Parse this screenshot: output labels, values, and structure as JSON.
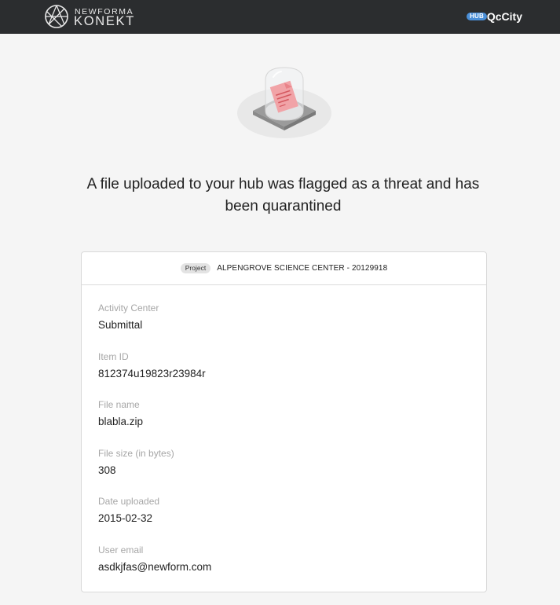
{
  "header": {
    "logo_top": "NEWFORMA",
    "logo_bottom": "KONEKT",
    "hub_badge": "HUB",
    "hub_name": "QcCity"
  },
  "message": {
    "headline": "A file uploaded to your hub was flagged as a threat and has been quarantined"
  },
  "card": {
    "project_badge": "Project",
    "project_name": "ALPENGROVE SCIENCE CENTER - 20129918",
    "fields": [
      {
        "label": "Activity Center",
        "value": "Submittal"
      },
      {
        "label": "Item ID",
        "value": "812374u19823r23984r"
      },
      {
        "label": "File name",
        "value": "blabla.zip"
      },
      {
        "label": "File size (in bytes)",
        "value": "308"
      },
      {
        "label": "Date uploaded",
        "value": "2015-02-32"
      },
      {
        "label": "User email",
        "value": "asdkjfas@newform.com"
      }
    ]
  },
  "colors": {
    "topbar": "#2b2d2f",
    "hub_badge": "#4a8fd8",
    "page_bg": "#f5f5f5",
    "card_bg": "#ffffff",
    "label": "#a6a6a6",
    "quarantined_file": "#f1a3a7"
  },
  "icons": {
    "logo": "newforma-logo-icon",
    "illustration": "quarantined-file-under-glass-dome-icon"
  }
}
